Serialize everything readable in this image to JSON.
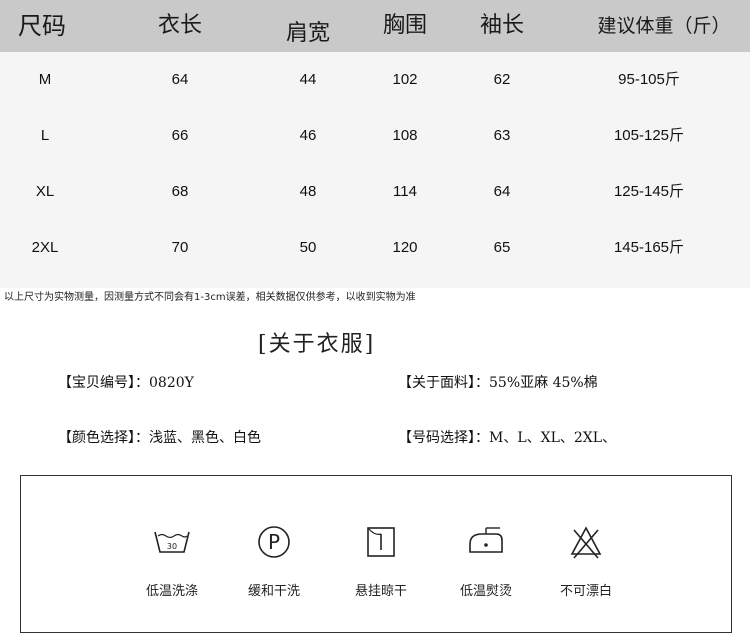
{
  "size_table": {
    "headers": [
      "尺码",
      "衣长",
      "肩宽",
      "胸围",
      "袖长",
      "建议体重（斤）"
    ],
    "rows": [
      [
        "M",
        "64",
        "44",
        "102",
        "62",
        "95-105斤"
      ],
      [
        "L",
        "66",
        "46",
        "108",
        "63",
        "105-125斤"
      ],
      [
        "XL",
        "68",
        "48",
        "114",
        "64",
        "125-145斤"
      ],
      [
        "2XL",
        "70",
        "50",
        "120",
        "65",
        "145-165斤"
      ]
    ]
  },
  "note": "以上尺寸为实物测量，因测量方式不同会有1-3cm误差，相关数据仅供参考，以收到实物为准",
  "about": {
    "title": "[关于衣服]",
    "item_no": "【宝贝编号】：0820Y",
    "fabric": "【关于面料】：55%亚麻  45%棉",
    "colors": "【颜色选择】：浅蓝、黑色、白色",
    "sizes": "【号码选择】：M、L、XL、2XL、"
  },
  "care": [
    {
      "icon": "wash-30-icon",
      "label": "低温洗涤",
      "wash_temp": "30"
    },
    {
      "icon": "dry-clean-p-icon",
      "label": "缓和干洗",
      "letter": "P"
    },
    {
      "icon": "hang-dry-icon",
      "label": "悬挂晾干"
    },
    {
      "icon": "low-iron-icon",
      "label": "低温熨烫"
    },
    {
      "icon": "no-bleach-icon",
      "label": "不可漂白"
    }
  ]
}
